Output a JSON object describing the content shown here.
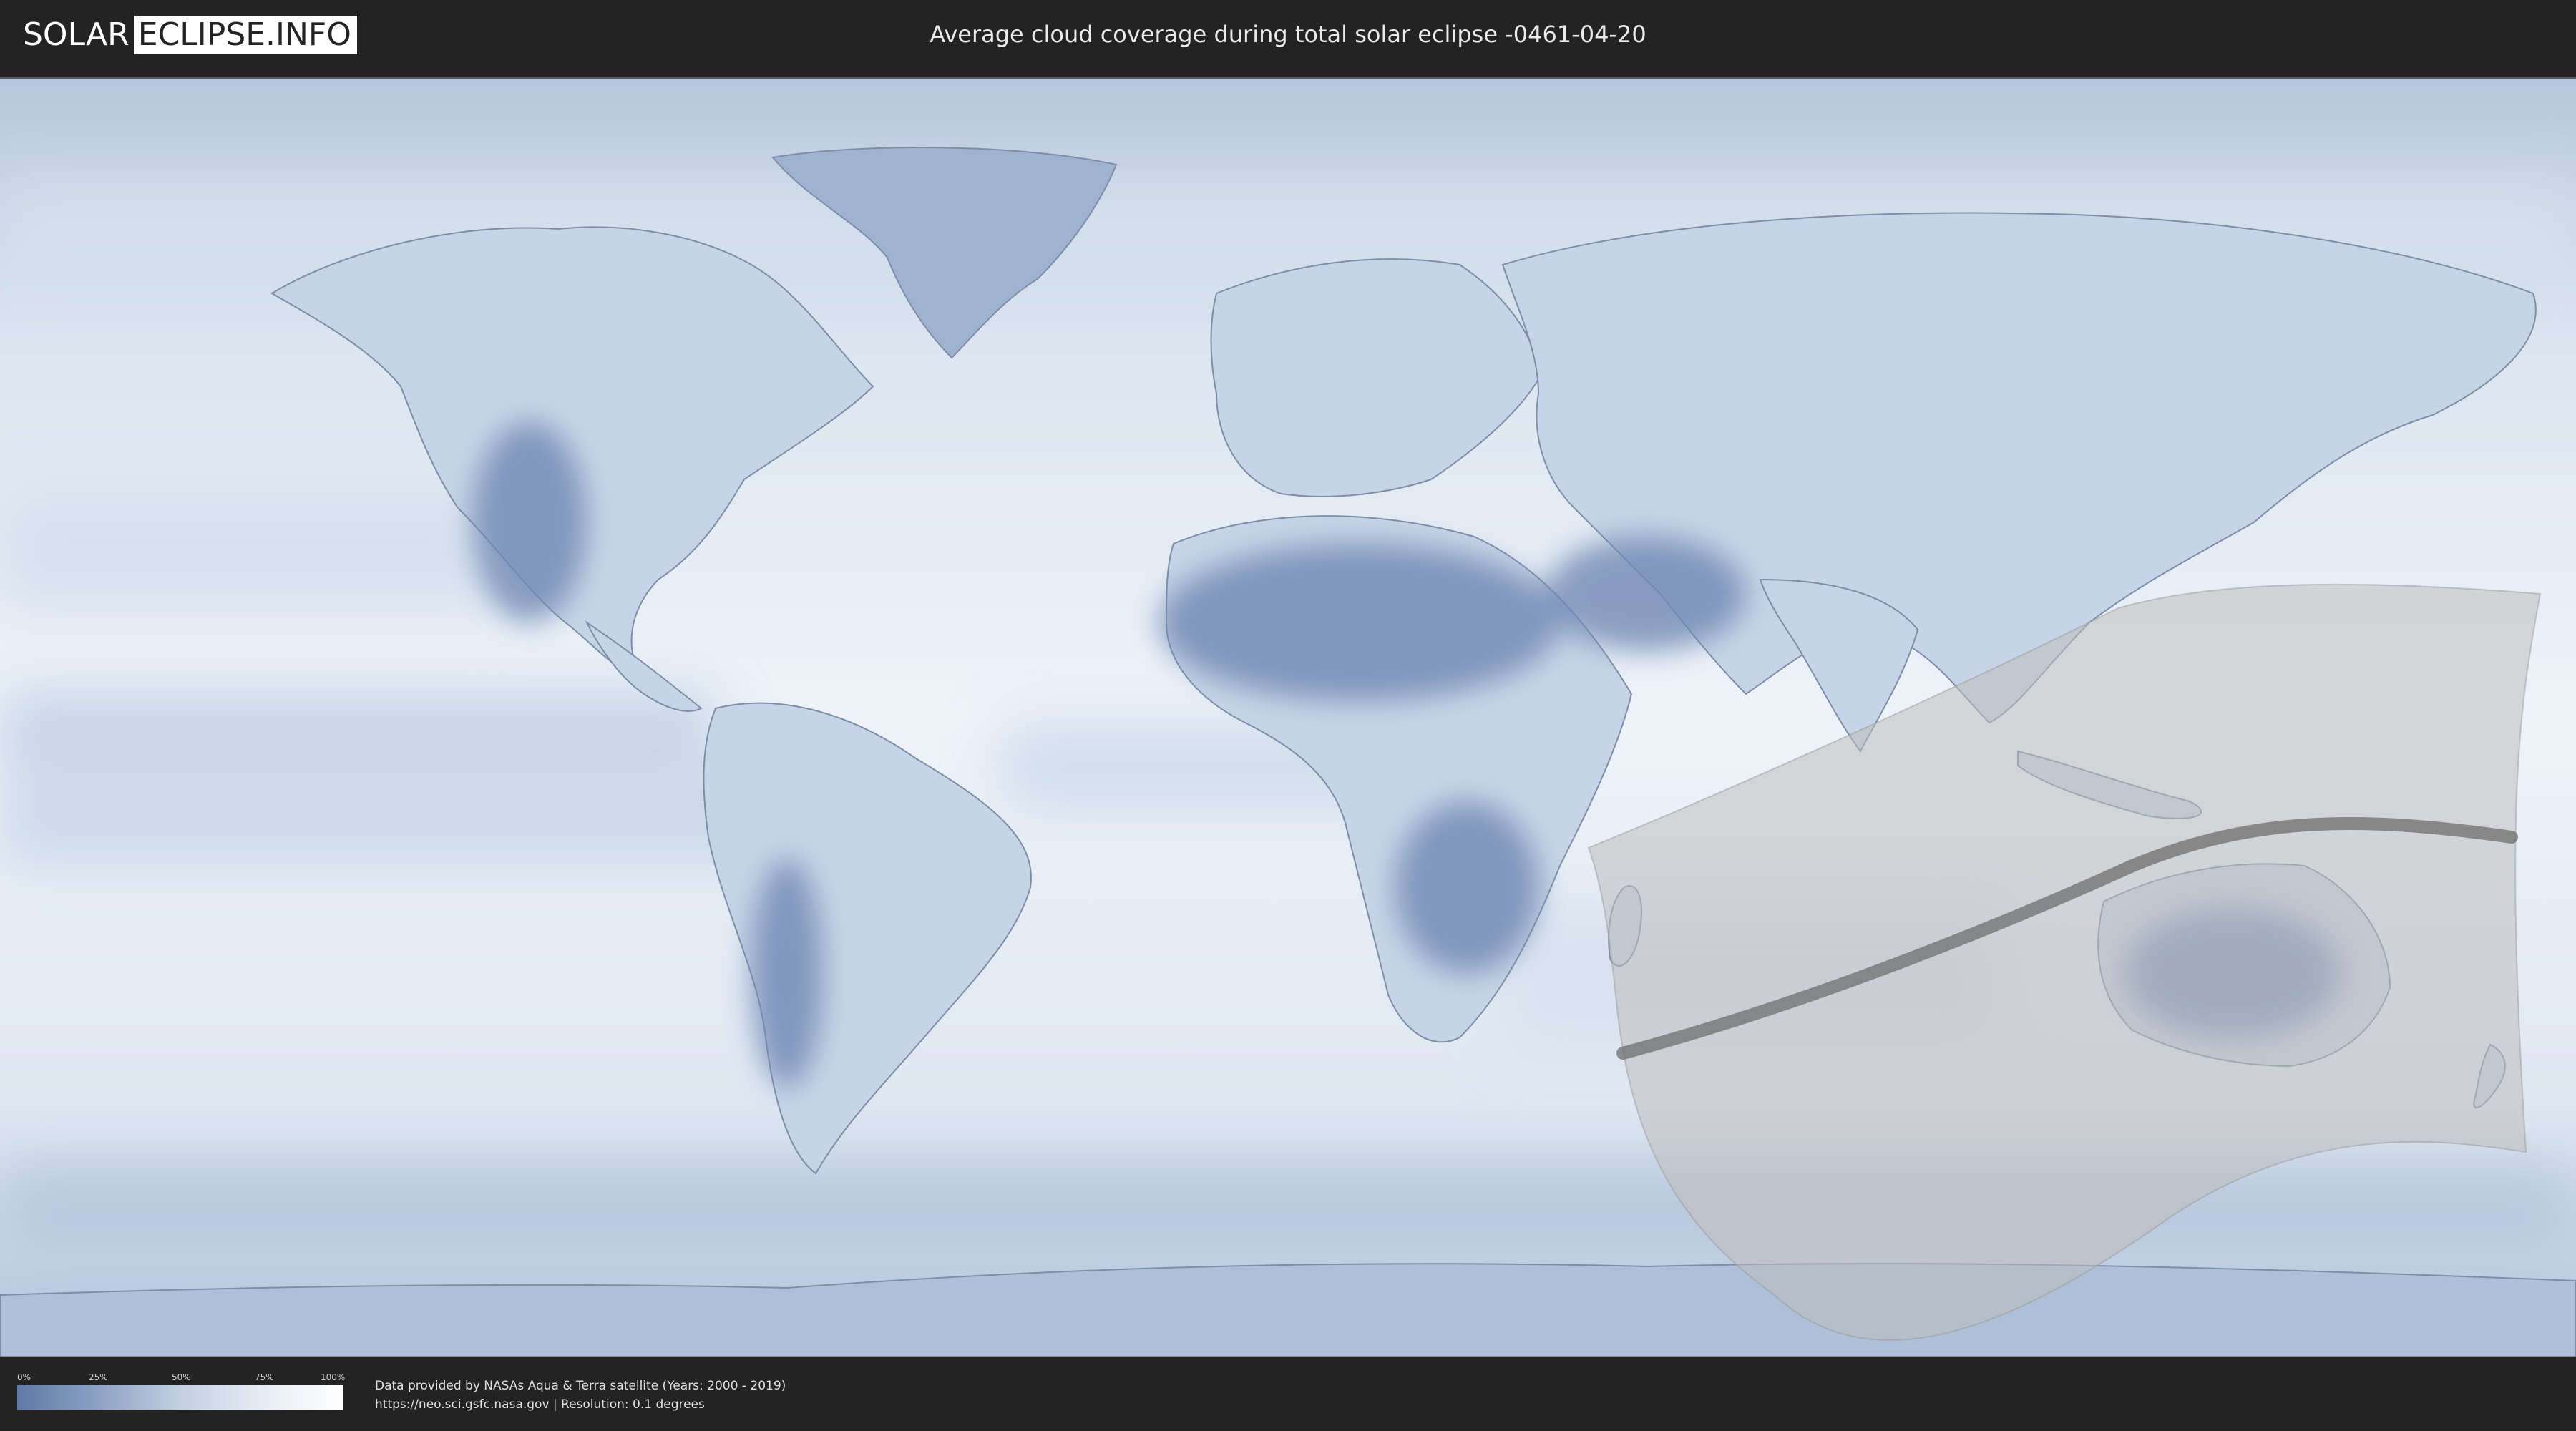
{
  "header": {
    "logo_left": "SOLAR",
    "logo_right": "ECLIPSE.INFO",
    "title": "Average cloud coverage during total solar eclipse -0461-04-20"
  },
  "legend": {
    "ticks": [
      "0%",
      "25%",
      "50%",
      "75%",
      "100%"
    ],
    "colors": {
      "low": "#5f79a6",
      "high": "#ffffff"
    }
  },
  "footer": {
    "credit_line1": "Data provided by NASAs Aqua & Terra satellite (Years: 2000 - 2019)",
    "credit_line2": "https://neo.sci.gsfc.nasa.gov | Resolution: 0.1 degrees"
  },
  "map": {
    "projection": "equirectangular",
    "colors": {
      "ocean_cloud": "#e9eff7",
      "dry_land": "#6f88b3",
      "path_overlay": "#bdbdbd",
      "central_line": "#6e6e6e"
    }
  }
}
